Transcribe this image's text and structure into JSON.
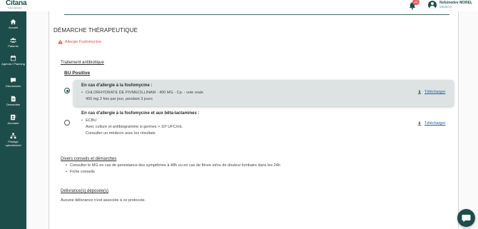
{
  "app": {
    "logo_text": "Citana",
    "logo_sub": "Votre assistant"
  },
  "header": {
    "notification_count": "10",
    "user_name": "Nolsinedev MOREL",
    "user_role": "Médecin"
  },
  "sidebar": {
    "items": [
      {
        "label": "Accueil",
        "icon": "home-icon"
      },
      {
        "label": "Patients",
        "icon": "users-icon"
      },
      {
        "label": "Agenda / Planning",
        "icon": "calendar-icon"
      },
      {
        "label": "Discussions",
        "icon": "chat-icon"
      },
      {
        "label": "Demandes",
        "icon": "document-icon"
      },
      {
        "label": "Annuaire",
        "icon": "directory-icon"
      },
      {
        "label": "Pilotage opérationnel",
        "icon": "hierarchy-icon"
      }
    ]
  },
  "content": {
    "section_title": "DÉMARCHE THÉRAPEUTIQUE",
    "allergy_text": "Allergie Fosfomycine",
    "treatment_title": "Traitement antibiotique",
    "bu_title": "BU Positive",
    "option1": {
      "heading": "En cas d'allergie à la fosfomycine :",
      "line1": "CHLORHYDRATE DE PIVMECILLINAM - 400 MG - Cp. - voie orale",
      "line2": "400 mg 2 fois par jour, pendant 3 jours",
      "download_label": "Télécharger",
      "selected": true
    },
    "option2": {
      "heading": "En cas d'allergie à la fosfomycine et aux bêta-lactamines :",
      "line1": "ECBU",
      "line2": "Avec culture et antibiogramme si germes > 10³ UFC/mL",
      "line3": "Consulter un médecin avec les résultats",
      "download_label": "Télécharger",
      "selected": false
    },
    "advice_title": "Divers conseils et démarches",
    "advice_items": [
      "Consulter le MG en cas de persistance des symptômes à 48h ou en cas de fièvre et/ou de douleur lombaire dans les 24h",
      "Fiche conseils"
    ],
    "delivery_title": "Délivrance(s) déposée(s)",
    "delivery_text": "Aucune délivrance n'est associée à ce protocole."
  },
  "colors": {
    "brand": "#1d4d4a",
    "alert": "#d9534f",
    "link": "#2a5d8a"
  }
}
